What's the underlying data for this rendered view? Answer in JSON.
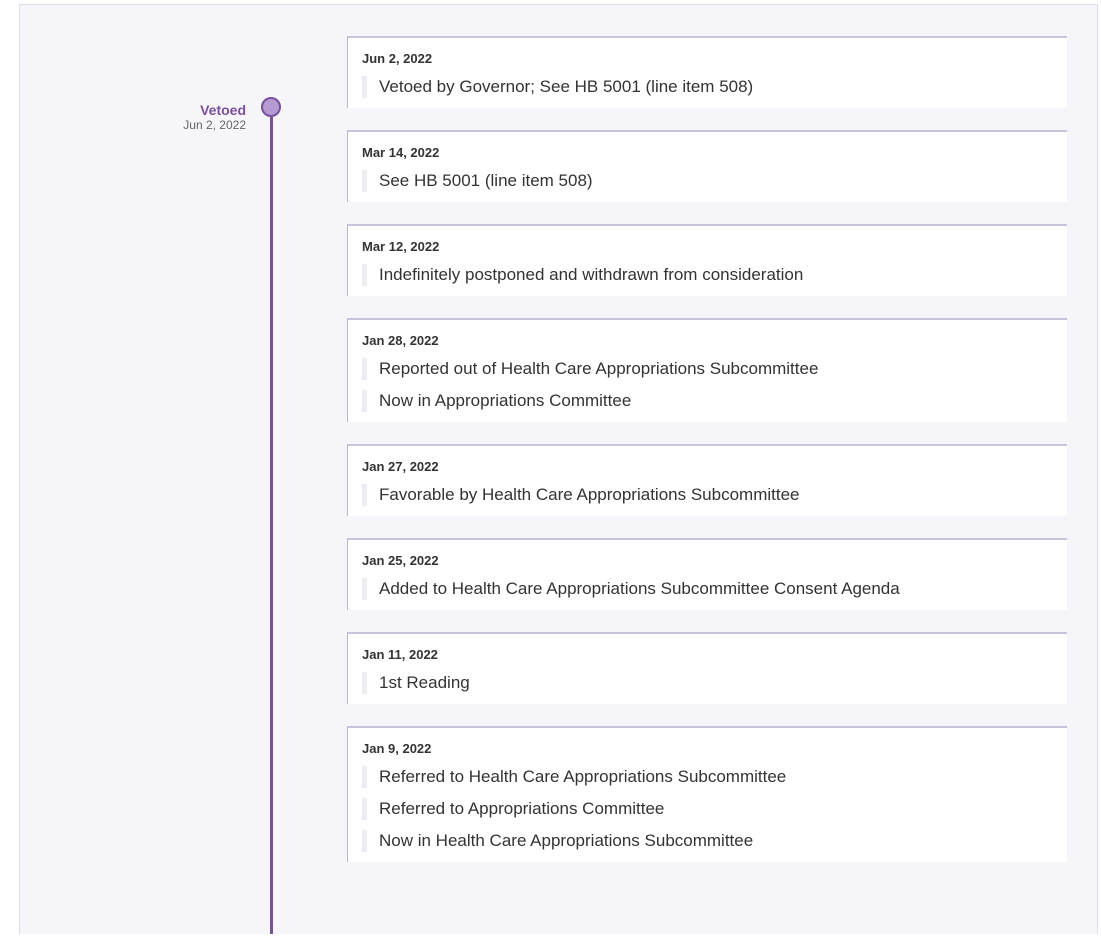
{
  "milestone": {
    "title": "Vetoed",
    "date": "Jun 2, 2022"
  },
  "entries": [
    {
      "date": "Jun 2, 2022",
      "actions": [
        "Vetoed by Governor; See HB 5001 (line item 508)"
      ]
    },
    {
      "date": "Mar 14, 2022",
      "actions": [
        "See HB 5001 (line item 508)"
      ]
    },
    {
      "date": "Mar 12, 2022",
      "actions": [
        "Indefinitely postponed and withdrawn from consideration"
      ]
    },
    {
      "date": "Jan 28, 2022",
      "actions": [
        "Reported out of Health Care Appropriations Subcommittee",
        "Now in Appropriations Committee"
      ]
    },
    {
      "date": "Jan 27, 2022",
      "actions": [
        "Favorable by Health Care Appropriations Subcommittee"
      ]
    },
    {
      "date": "Jan 25, 2022",
      "actions": [
        "Added to Health Care Appropriations Subcommittee Consent Agenda"
      ]
    },
    {
      "date": "Jan 11, 2022",
      "actions": [
        "1st Reading"
      ]
    },
    {
      "date": "Jan 9, 2022",
      "actions": [
        "Referred to Health Care Appropriations Subcommittee",
        "Referred to Appropriations Committee",
        "Now in Health Care Appropriations Subcommittee"
      ]
    }
  ]
}
